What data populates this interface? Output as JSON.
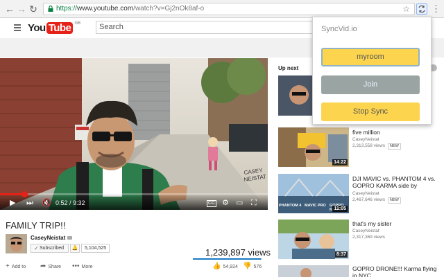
{
  "browser": {
    "back_icon": "back-arrow-icon",
    "forward_icon": "forward-arrow-icon",
    "reload_icon": "reload-icon",
    "url_secure": "https://",
    "url_host": "www.youtube.com",
    "url_path": "/watch?v=Gj2nOk8af-o"
  },
  "youtube": {
    "logo_you": "You",
    "logo_tube": "Tube",
    "logo_region": "GB",
    "search_placeholder": "Search",
    "brand_color": "#e62117"
  },
  "player": {
    "time": "0:52 / 9:32",
    "progress_fraction": 0.091
  },
  "video": {
    "title": "FAMILY TRIP!!",
    "channel": "CaseyNeistat",
    "subscribed_label": "Subscribed",
    "subscriber_count": "5,104,525",
    "views": "1,239,897 views",
    "like_ratio": 0.98,
    "add_to_label": "Add to",
    "share_label": "Share",
    "more_label": "More",
    "likes": "54,924",
    "dislikes": "576"
  },
  "sidebar": {
    "up_next_label": "Up next",
    "items": [
      {
        "title": "five million",
        "channel": "CaseyNeistat",
        "views": "2,313,558 views",
        "badge": "NEW",
        "duration": "14:22"
      },
      {
        "title": "DJI MAVIC vs. PHANTOM 4 vs. GOPRO KARMA side by",
        "channel": "CaseyNeistat",
        "views": "2,467,646 views",
        "badge": "NEW",
        "duration": "11:05",
        "thumb_labels": [
          "PHANTOM 4",
          "MAVIC PRO",
          "GOPRO KARMA"
        ]
      },
      {
        "title": "that's my sister",
        "channel": "CaseyNeistat",
        "views": "2,317,369 views",
        "badge": "",
        "duration": "8:37"
      },
      {
        "title": "GOPRO DRONE!!! Karma flying in NYC",
        "channel": "",
        "views": "",
        "badge": "",
        "duration": ""
      }
    ]
  },
  "extension": {
    "title": "SyncVid.io",
    "room_label": "myroom",
    "join_label": "Join",
    "stop_label": "Stop Sync"
  }
}
